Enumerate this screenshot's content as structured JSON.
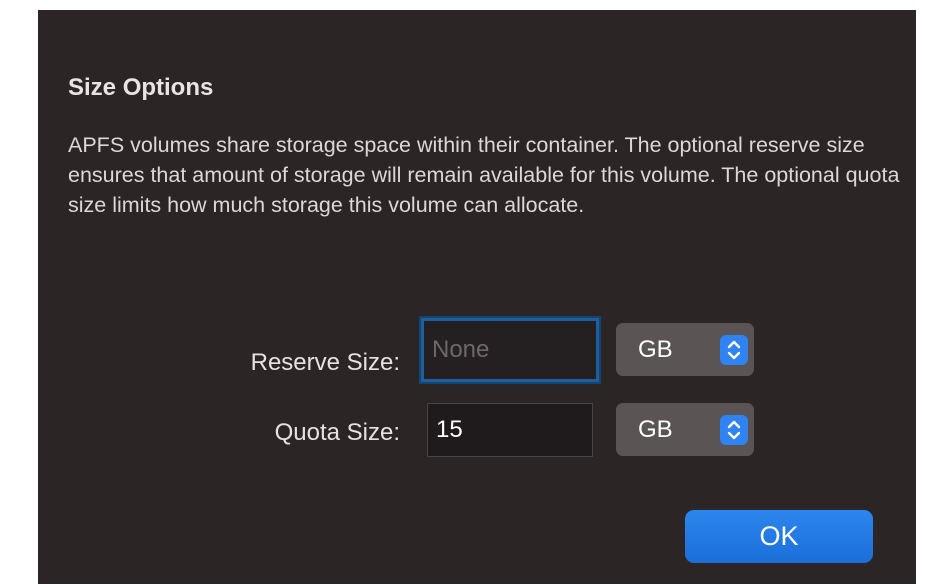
{
  "dialog": {
    "title": "Size Options",
    "description": "APFS volumes share storage space within their container. The optional reserve size ensures that amount of storage will remain available for this volume. The optional quota size limits how much storage this volume can allocate."
  },
  "reserve": {
    "label": "Reserve Size:",
    "value": "",
    "placeholder": "None",
    "unit": "GB"
  },
  "quota": {
    "label": "Quota Size:",
    "value": "15",
    "placeholder": "",
    "unit": "GB"
  },
  "buttons": {
    "ok_label": "OK"
  },
  "colors": {
    "background": "#2b2526",
    "accent": "#2f83f2",
    "focus_ring": "#1d5f9a"
  },
  "icons": {
    "popup_stepper": "up-down-chevron-icon"
  }
}
